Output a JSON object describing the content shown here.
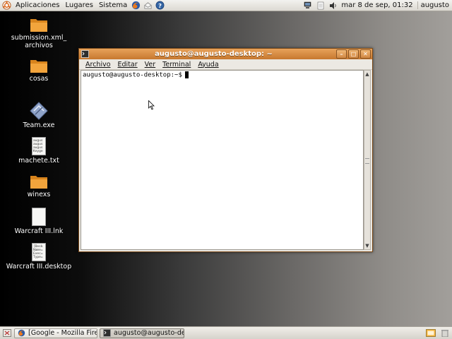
{
  "top_panel": {
    "menus": [
      "Aplicaciones",
      "Lugares",
      "Sistema"
    ],
    "clock": "mar 8 de sep, 01:32",
    "username": "augusto"
  },
  "desktop_icons": [
    {
      "label": "submission.xml_\narchivos",
      "icon": "folder-icon"
    },
    {
      "label": "cosas",
      "icon": "folder-icon"
    },
    {
      "label": "Team.exe",
      "icon": "exe-icon"
    },
    {
      "label": "machete.txt",
      "icon": "text-file-icon",
      "preview": [
        "augus",
        "augus",
        "augus",
        "Keyge"
      ]
    },
    {
      "label": "winexs",
      "icon": "folder-icon"
    },
    {
      "label": "Warcraft III.lnk",
      "icon": "blank-file-icon"
    },
    {
      "label": "Warcraft III.desktop",
      "icon": "desktop-file-icon",
      "preview": [
        "[Desk",
        "Name=",
        "Exec=",
        "Type="
      ]
    }
  ],
  "terminal": {
    "title": "augusto@augusto-desktop: ~",
    "menus": [
      "Archivo",
      "Editar",
      "Ver",
      "Terminal",
      "Ayuda"
    ],
    "prompt": "augusto@augusto-desktop:~$"
  },
  "taskbar": {
    "tasks": [
      {
        "label": "[Google - Mozilla Firef...",
        "icon": "firefox-icon"
      },
      {
        "label": "augusto@augusto-des...",
        "icon": "terminal-icon"
      }
    ]
  },
  "colors": {
    "titlebar": "#d18843",
    "panel": "#e6e3dc",
    "folder": "#f09a2c"
  }
}
